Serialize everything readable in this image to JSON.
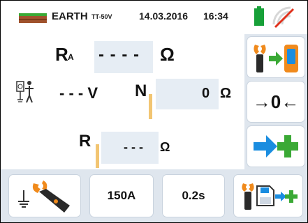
{
  "header": {
    "mode": "EARTH",
    "sub_mode": "TT-50V",
    "date": "14.03.2016",
    "time": "16:34",
    "battery_color": "#17a038",
    "icons": [
      "earth-strip-icon",
      "battery-icon",
      "no-signal-icon"
    ]
  },
  "main": {
    "ra": {
      "label": "R",
      "sub": "A",
      "value": "- - - -",
      "unit": "Ω"
    },
    "voltage": {
      "value": "- - - V"
    },
    "n": {
      "label": "N",
      "value": "0",
      "unit": "Ω"
    },
    "r": {
      "label": "R",
      "value": "- - -",
      "unit": "Ω"
    }
  },
  "sidebar": {
    "zero_label": "→0←"
  },
  "footer": {
    "range_label": "150A",
    "time_label": "0.2s"
  },
  "colors": {
    "accent_blue": "#1a8de0",
    "accent_green": "#3aa935",
    "clamp_orange": "#f08a1c",
    "cursor_orange": "#f2c572"
  }
}
